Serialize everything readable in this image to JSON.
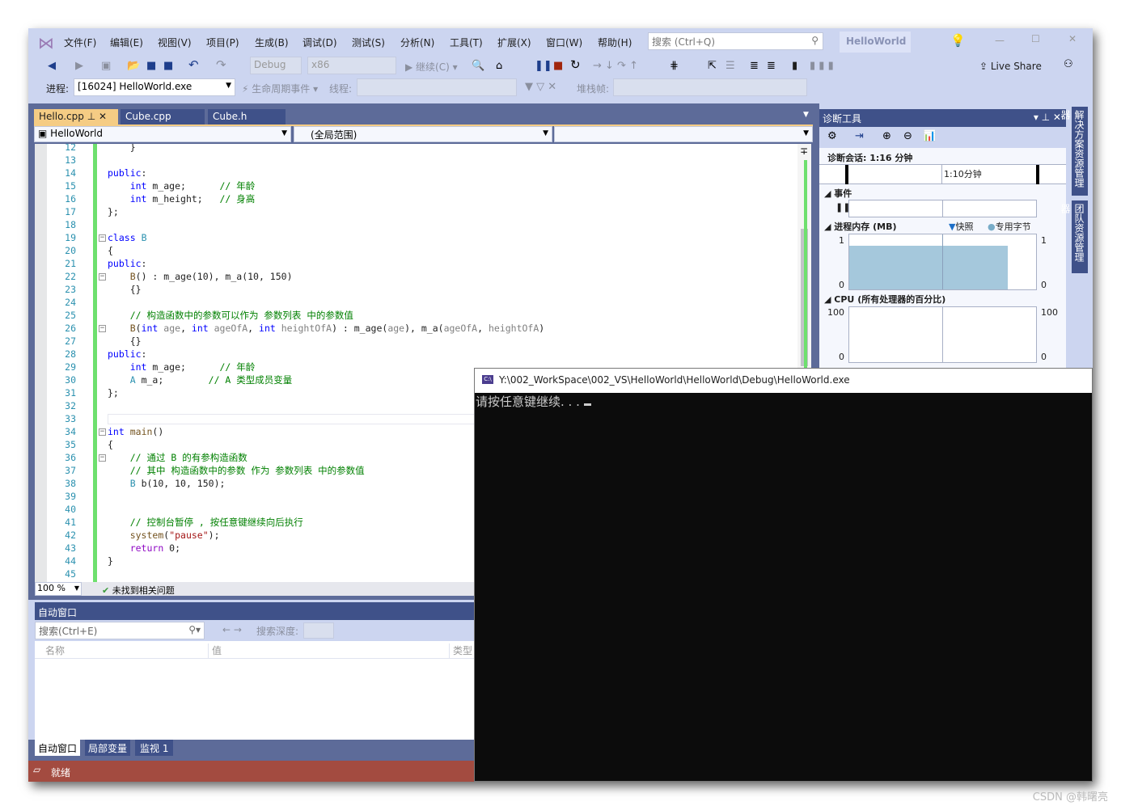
{
  "menu": [
    "文件(F)",
    "编辑(E)",
    "视图(V)",
    "项目(P)",
    "生成(B)",
    "调试(D)",
    "测试(S)",
    "分析(N)",
    "工具(T)",
    "扩展(X)",
    "窗口(W)",
    "帮助(H)"
  ],
  "search_placeholder": "搜索 (Ctrl+Q)",
  "solution_name": "HelloWorld",
  "toolbar": {
    "config": "Debug",
    "platform": "x86",
    "continue": "继续(C)",
    "live_share": "Live Share"
  },
  "toolbar2": {
    "process_label": "进程:",
    "process_value": "[16024] HelloWorld.exe",
    "lifecycle": "生命周期事件",
    "thread_label": "线程:",
    "stackframe_label": "堆栈帧:"
  },
  "tabs": [
    {
      "label": "Hello.cpp",
      "active": true
    },
    {
      "label": "Cube.cpp"
    },
    {
      "label": "Cube.h"
    }
  ],
  "nav": {
    "project": "HelloWorld",
    "scope": "(全局范围)"
  },
  "code_lines": [
    {
      "n": "12",
      "s": [
        [
          "    }",
          "pl"
        ]
      ]
    },
    {
      "n": "13",
      "s": []
    },
    {
      "n": "14",
      "s": [
        [
          "public",
          "kw"
        ],
        [
          ":",
          "pl"
        ]
      ]
    },
    {
      "n": "15",
      "s": [
        [
          "    ",
          "pl"
        ],
        [
          "int",
          "kw"
        ],
        [
          " m_age;      ",
          "pl"
        ],
        [
          "// 年龄",
          "cm"
        ]
      ]
    },
    {
      "n": "16",
      "s": [
        [
          "    ",
          "pl"
        ],
        [
          "int",
          "kw"
        ],
        [
          " m_height;   ",
          "pl"
        ],
        [
          "// 身高",
          "cm"
        ]
      ]
    },
    {
      "n": "17",
      "s": [
        [
          "};",
          "pl"
        ]
      ]
    },
    {
      "n": "18",
      "s": []
    },
    {
      "n": "19",
      "s": [
        [
          "class",
          "kw"
        ],
        [
          " ",
          "pl"
        ],
        [
          "B",
          "ty"
        ]
      ],
      "fold": true
    },
    {
      "n": "20",
      "s": [
        [
          "{",
          "pl"
        ]
      ]
    },
    {
      "n": "21",
      "s": [
        [
          "public",
          "kw"
        ],
        [
          ":",
          "pl"
        ]
      ]
    },
    {
      "n": "22",
      "s": [
        [
          "    ",
          "pl"
        ],
        [
          "B",
          "fn"
        ],
        [
          "() : m_age(10), m_a(10, 150)",
          "pl"
        ]
      ],
      "fold": true
    },
    {
      "n": "23",
      "s": [
        [
          "    {}",
          "pl"
        ]
      ]
    },
    {
      "n": "24",
      "s": []
    },
    {
      "n": "25",
      "s": [
        [
          "    ",
          "pl"
        ],
        [
          "// 构造函数中的参数可以作为 参数列表 中的参数值",
          "cm"
        ]
      ]
    },
    {
      "n": "26",
      "s": [
        [
          "    ",
          "pl"
        ],
        [
          "B",
          "fn"
        ],
        [
          "(",
          "pl"
        ],
        [
          "int",
          "kw"
        ],
        [
          " age",
          "pr"
        ],
        [
          ", ",
          "pl"
        ],
        [
          "int",
          "kw"
        ],
        [
          " ageOfA",
          "pr"
        ],
        [
          ", ",
          "pl"
        ],
        [
          "int",
          "kw"
        ],
        [
          " heightOfA",
          "pr"
        ],
        [
          ") : m_age(",
          "pl"
        ],
        [
          "age",
          "pr"
        ],
        [
          "), m_a(",
          "pl"
        ],
        [
          "ageOfA",
          "pr"
        ],
        [
          ", ",
          "pl"
        ],
        [
          "heightOfA",
          "pr"
        ],
        [
          ")",
          "pl"
        ]
      ],
      "fold": true
    },
    {
      "n": "27",
      "s": [
        [
          "    {}",
          "pl"
        ]
      ]
    },
    {
      "n": "28",
      "s": [
        [
          "public",
          "kw"
        ],
        [
          ":",
          "pl"
        ]
      ]
    },
    {
      "n": "29",
      "s": [
        [
          "    ",
          "pl"
        ],
        [
          "int",
          "kw"
        ],
        [
          " m_age;      ",
          "pl"
        ],
        [
          "// 年龄",
          "cm"
        ]
      ]
    },
    {
      "n": "30",
      "s": [
        [
          "    ",
          "pl"
        ],
        [
          "A",
          "ty"
        ],
        [
          " m_a;        ",
          "pl"
        ],
        [
          "// A 类型成员变量",
          "cm"
        ]
      ]
    },
    {
      "n": "31",
      "s": [
        [
          "};",
          "pl"
        ]
      ]
    },
    {
      "n": "32",
      "s": []
    },
    {
      "n": "33",
      "s": []
    },
    {
      "n": "34",
      "s": [
        [
          "int",
          "kw"
        ],
        [
          " ",
          "pl"
        ],
        [
          "main",
          "fn"
        ],
        [
          "()",
          "pl"
        ]
      ],
      "fold": true
    },
    {
      "n": "35",
      "s": [
        [
          "{",
          "pl"
        ]
      ]
    },
    {
      "n": "36",
      "s": [
        [
          "    ",
          "pl"
        ],
        [
          "// 通过 B 的有参构造函数",
          "cm"
        ]
      ],
      "fold": true
    },
    {
      "n": "37",
      "s": [
        [
          "    ",
          "pl"
        ],
        [
          "// 其中 构造函数中的参数 作为 参数列表 中的参数值",
          "cm"
        ]
      ]
    },
    {
      "n": "38",
      "s": [
        [
          "    ",
          "pl"
        ],
        [
          "B",
          "ty"
        ],
        [
          " b(10, 10, 150);",
          "pl"
        ]
      ]
    },
    {
      "n": "39",
      "s": []
    },
    {
      "n": "40",
      "s": []
    },
    {
      "n": "41",
      "s": [
        [
          "    ",
          "pl"
        ],
        [
          "// 控制台暂停 , 按任意键继续向后执行",
          "cm"
        ]
      ]
    },
    {
      "n": "42",
      "s": [
        [
          "    ",
          "pl"
        ],
        [
          "system",
          "fn"
        ],
        [
          "(",
          "pl"
        ],
        [
          "\"pause\"",
          "str"
        ],
        [
          ");",
          "pl"
        ]
      ]
    },
    {
      "n": "43",
      "s": [
        [
          "    ",
          "pl"
        ],
        [
          "return",
          "ctl"
        ],
        [
          " 0;",
          "pl"
        ]
      ]
    },
    {
      "n": "44",
      "s": [
        [
          "}",
          "pl"
        ]
      ]
    },
    {
      "n": "45",
      "s": []
    }
  ],
  "editor_status": {
    "zoom": "100 %",
    "issues": "未找到相关问题"
  },
  "diag": {
    "title": "诊断工具",
    "session": "诊断会话: 1:16 分钟",
    "timeline_label": "1:10分钟",
    "events": "事件",
    "memory": "进程内存 (MB)",
    "snapshot": "快照",
    "private_bytes": "专用字节",
    "mem_max": "1",
    "mem_min": "0",
    "cpu": "CPU (所有处理器的百分比)",
    "cpu_max": "100",
    "cpu_min": "0",
    "memory_level_fraction": 0.8
  },
  "side_tabs": [
    "解决方案资源管理器",
    "团队资源管理器"
  ],
  "autos": {
    "title": "自动窗口",
    "search_placeholder": "搜索(Ctrl+E)",
    "depth_label": "搜索深度:",
    "columns": [
      "名称",
      "值",
      "类型"
    ],
    "tabs": [
      "自动窗口",
      "局部变量",
      "监视 1"
    ]
  },
  "status": {
    "text": "就绪"
  },
  "console": {
    "title": "Y:\\002_WorkSpace\\002_VS\\HelloWorld\\HelloWorld\\Debug\\HelloWorld.exe",
    "output": "请按任意键继续. . . "
  },
  "watermark": "CSDN @韩曙亮",
  "colors": {
    "status_bar": "#a34b40",
    "active_tab": "#f5cc84",
    "chrome": "#ccd5f0",
    "panel_header": "#3f5189"
  }
}
